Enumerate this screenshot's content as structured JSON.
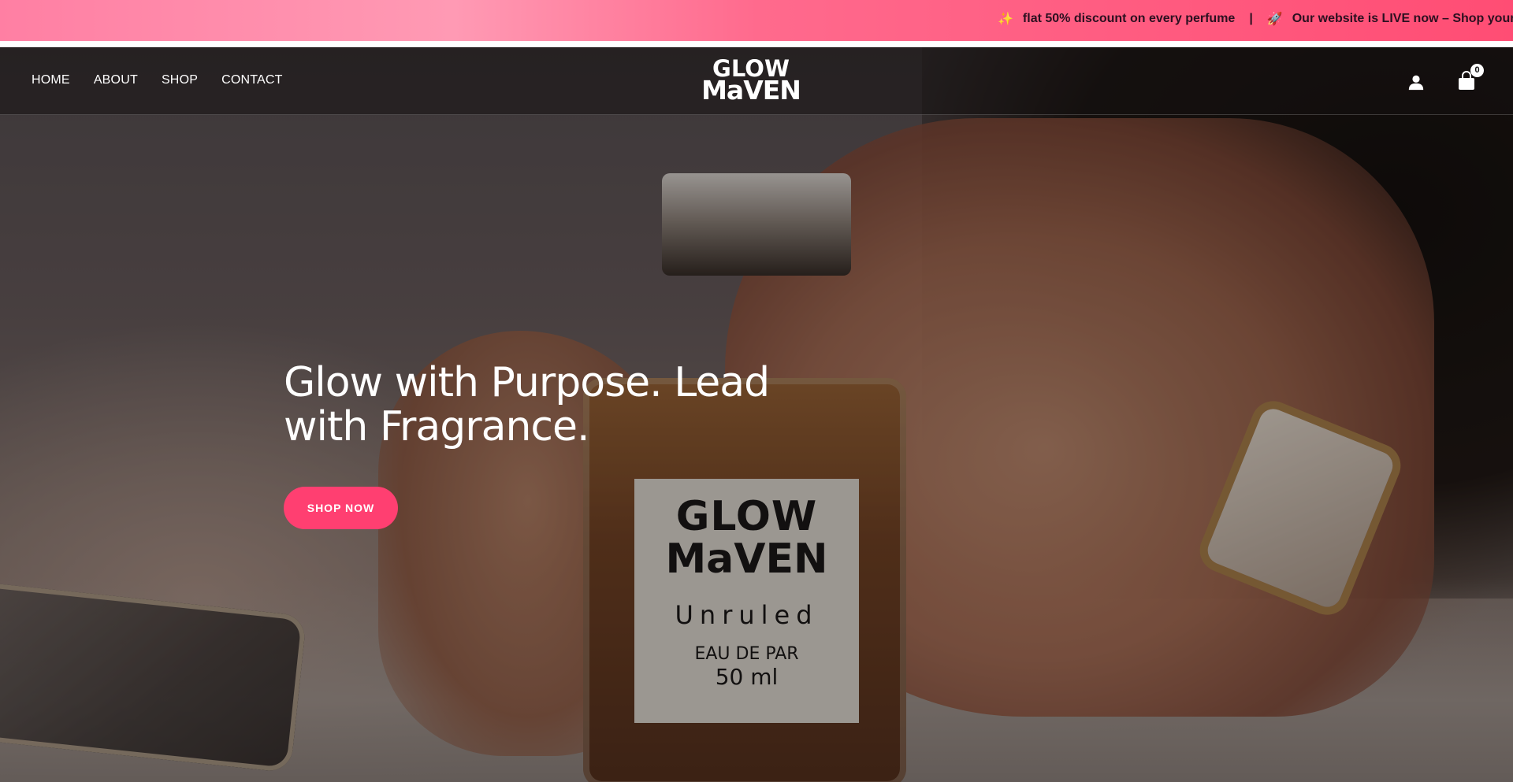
{
  "announcement": {
    "items": [
      {
        "icon": "sparkles-icon",
        "glyph": "✨",
        "text": "flat 50% discount on every perfume"
      },
      {
        "icon": "rocket-icon",
        "glyph": "🚀",
        "text": "Our website is LIVE now – Shop your fav"
      }
    ],
    "separator": "|"
  },
  "nav": {
    "items": [
      "HOME",
      "ABOUT",
      "SHOP",
      "CONTACT"
    ]
  },
  "logo": {
    "top": "GLOW",
    "bottom": "MaVEN"
  },
  "header_icons": {
    "user": "user-icon",
    "cart": "shopping-bag-icon",
    "cart_count": "0"
  },
  "hero": {
    "headline": "Glow with Purpose. Lead with Fragrance.",
    "cta": "SHOP NOW",
    "bottle_label": {
      "line1": "GLOW",
      "line2": "MaVEN",
      "line3": "Unruled",
      "line4": "EAU DE PAR",
      "line5": "50 ml"
    }
  },
  "colors": {
    "accent": "#ff3f71",
    "announce_bg": "#ff5a82"
  }
}
